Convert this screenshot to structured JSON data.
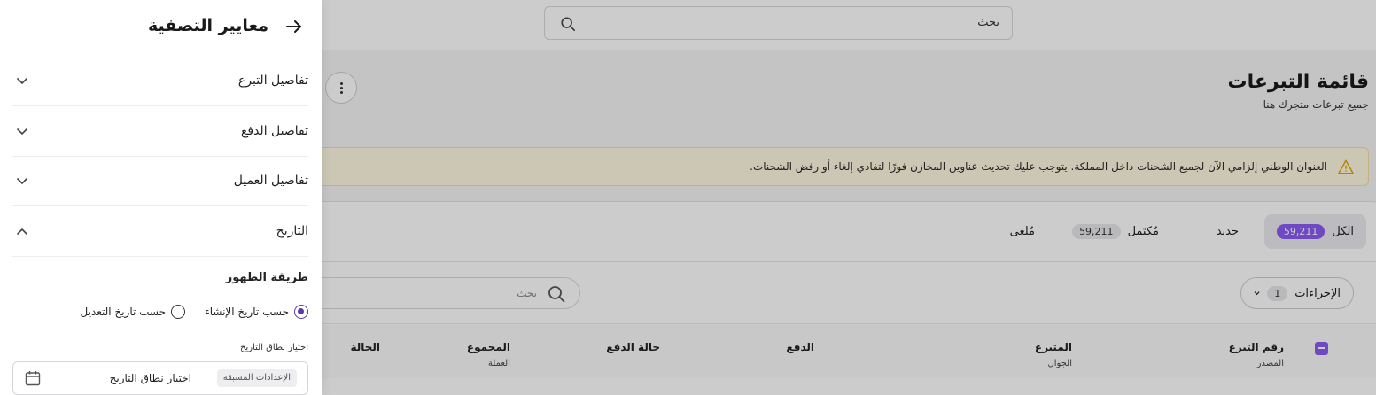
{
  "topbar": {
    "search_placeholder": "بحث"
  },
  "page": {
    "title": "قائمة التبرعات",
    "subtitle": "جميع تبرعات متجرك هنا"
  },
  "alert": {
    "text": "العنوان الوطني إلزامي الآن لجميع الشحنات داخل المملكة. يتوجب عليك تحديث عناوين المخازن فورًا لتفادي إلغاء أو رفض الشحنات."
  },
  "tabs": [
    {
      "label": "الكل",
      "count": "59,211",
      "active": true
    },
    {
      "label": "جديد",
      "count": ""
    },
    {
      "label": "مُكتمل",
      "count": "59,211"
    },
    {
      "label": "مُلغى",
      "count": ""
    }
  ],
  "toolbar": {
    "actions_label": "الإجراءات",
    "actions_count": "1",
    "search_placeholder": "بحث"
  },
  "table": {
    "columns": [
      {
        "title": "رقم التبرع",
        "sub": "المصدر"
      },
      {
        "title": "المتبرع",
        "sub": "الجوال"
      },
      {
        "title": "الدفع",
        "sub": ""
      },
      {
        "title": "حالة الدفع",
        "sub": ""
      },
      {
        "title": "المجموع",
        "sub": "العملة"
      },
      {
        "title": "الحالة",
        "sub": ""
      }
    ]
  },
  "drawer": {
    "title": "معايير التصفية",
    "sections": [
      {
        "label": "تفاصيل التبرع",
        "expanded": false
      },
      {
        "label": "تفاصيل الدفع",
        "expanded": false
      },
      {
        "label": "تفاصيل العميل",
        "expanded": false
      },
      {
        "label": "التاريخ",
        "expanded": true
      }
    ],
    "display_method_label": "طريقة الظهور",
    "radio_options": [
      {
        "label": "حسب تاريخ الإنشاء",
        "selected": true
      },
      {
        "label": "حسب تاريخ التعديل",
        "selected": false
      }
    ],
    "range_label": "اختيار نطاق التاريخ",
    "presets_label": "الإعدادات المسبقة",
    "range_placeholder": "اختيار نطاق التاريخ"
  },
  "colors": {
    "accent": "#8b5cf6",
    "radio": "#5b3aa8",
    "alert_bg": "#fff8e1",
    "warning_icon": "#e0a800"
  }
}
